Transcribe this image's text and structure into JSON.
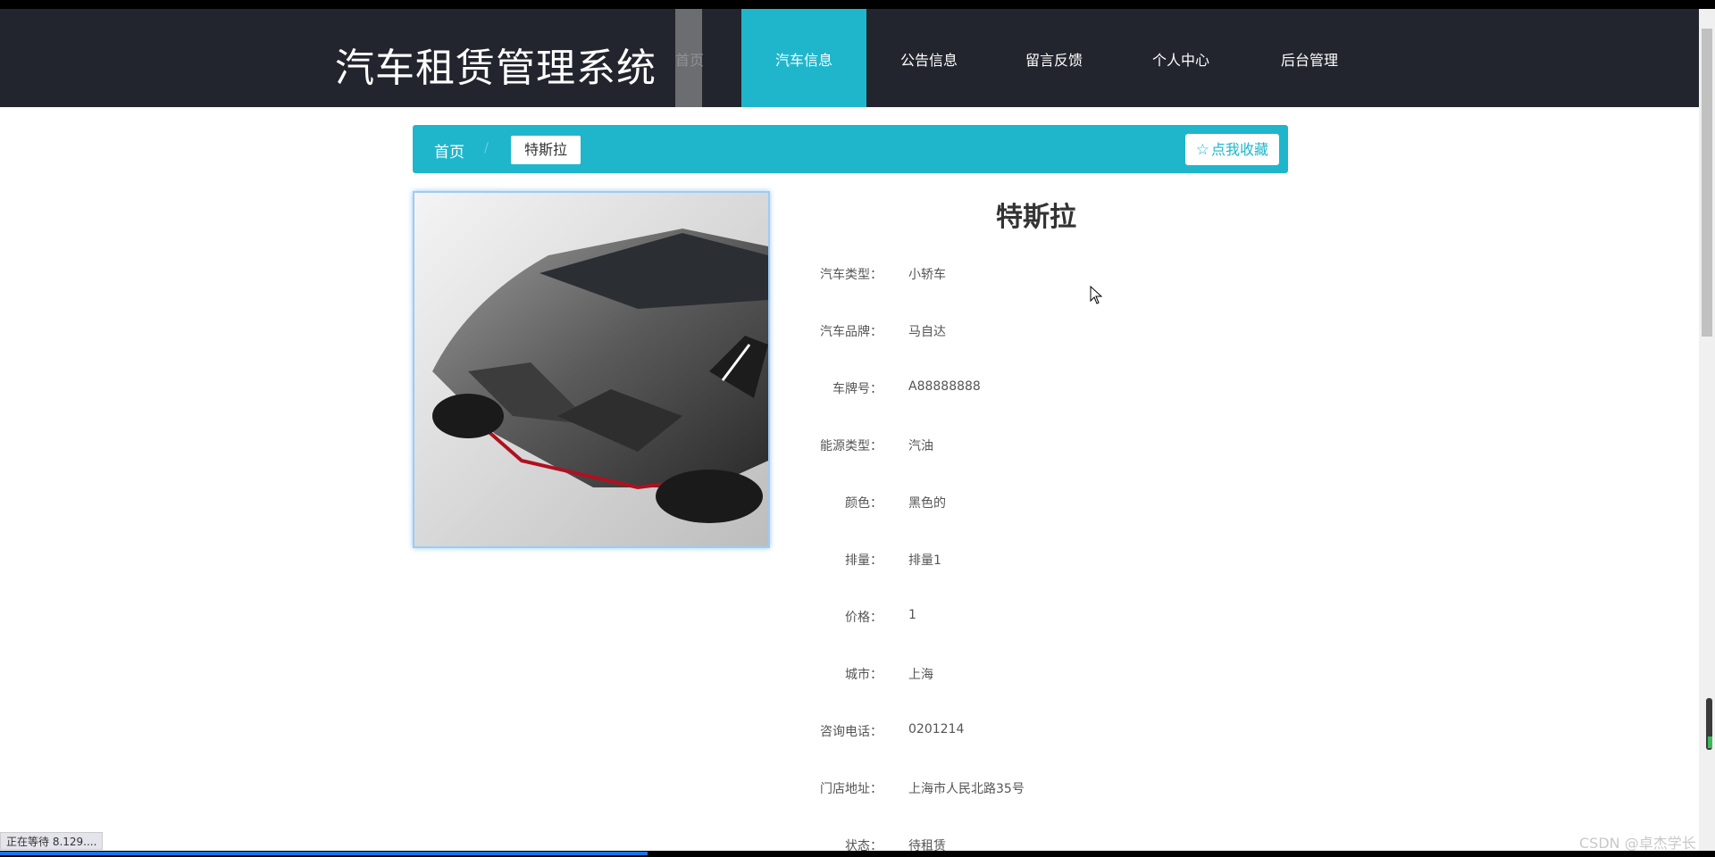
{
  "header": {
    "site_title": "汽车租赁管理系统",
    "nav": [
      {
        "label": "首页"
      },
      {
        "label": "汽车信息"
      },
      {
        "label": "公告信息"
      },
      {
        "label": "留言反馈"
      },
      {
        "label": "个人中心"
      },
      {
        "label": "后台管理"
      }
    ]
  },
  "breadcrumb": {
    "home": "首页",
    "separator": "/",
    "current": "特斯拉",
    "favorite_label": "点我收藏"
  },
  "detail": {
    "title": "特斯拉",
    "fields": [
      {
        "label": "汽车类型：",
        "value": "小轿车"
      },
      {
        "label": "汽车品牌：",
        "value": "马自达"
      },
      {
        "label": "车牌号：",
        "value": "A88888888"
      },
      {
        "label": "能源类型：",
        "value": "汽油"
      },
      {
        "label": "颜色：",
        "value": "黑色的"
      },
      {
        "label": "排量：",
        "value": "排量1"
      },
      {
        "label": "价格：",
        "value": "1"
      },
      {
        "label": "城市：",
        "value": "上海"
      },
      {
        "label": "咨询电话：",
        "value": "0201214"
      },
      {
        "label": "门店地址：",
        "value": "上海市人民北路35号"
      },
      {
        "label": "状态：",
        "value": "待租赁"
      }
    ]
  },
  "browser": {
    "status_text": "正在等待 8.129....",
    "watermark": "CSDN @卓杰学长"
  },
  "colors": {
    "nav_bg": "#23252e",
    "accent": "#1fb6cb"
  }
}
